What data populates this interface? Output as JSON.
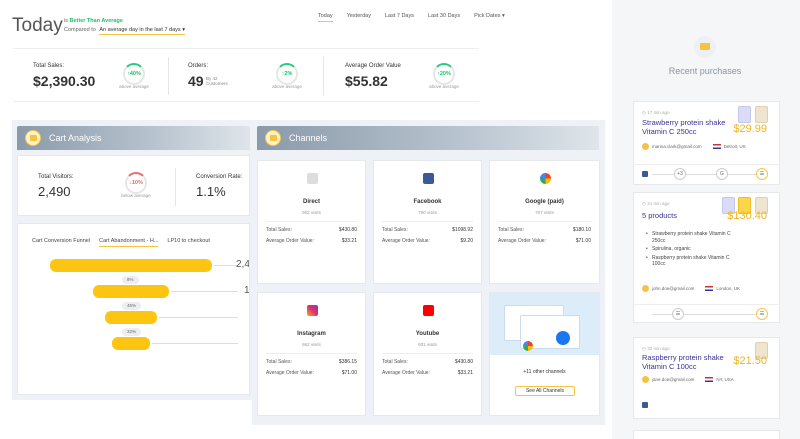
{
  "header": {
    "title": "Today",
    "status_prefix": "is",
    "status_value": "Better Than Average",
    "compare_prefix": "Compared to",
    "compare_value": "An average day in the last 7 days"
  },
  "date_tabs": [
    "Today",
    "Yesterday",
    "Last 7 Days",
    "Last 30 Days",
    "Pick Dates"
  ],
  "kpis": {
    "sales": {
      "label": "Total Sales:",
      "value": "$2,390.30",
      "pct": "40%",
      "caption": "above average"
    },
    "orders": {
      "label": "Orders:",
      "value": "49",
      "sub": "By 42 Customers",
      "pct": "2%",
      "caption": "above average"
    },
    "aov": {
      "label": "Average Order Value",
      "value": "$55.82",
      "pct": "20%",
      "caption": "above average"
    }
  },
  "cart": {
    "title": "Cart Analysis",
    "visitors_label": "Total Visitors:",
    "visitors_value": "2,490",
    "visitors_pct": "10%",
    "visitors_caption": "below average",
    "conv_label": "Conversion Rate:",
    "conv_value": "1.1%",
    "funnel_tabs": [
      "Cart Conversion Funnel",
      "Cart Abandonment - H...",
      "LP10 to checkout"
    ],
    "funnel": {
      "steps": [
        1.0,
        0.47,
        0.32,
        0.24
      ],
      "pills": [
        "8%",
        "45%",
        "32%"
      ],
      "num_top": "2,4",
      "num_mid": "1"
    }
  },
  "channels": {
    "title": "Channels",
    "sales_label": "Total Sales:",
    "aov_label": "Average Order Value:",
    "items": [
      {
        "name": "Direct",
        "visits": "952 visits",
        "sales": "$430.80",
        "aov": "$33.21",
        "icon": "direct-icon",
        "color": "#cccccc"
      },
      {
        "name": "Facebook",
        "visits": "790 visits",
        "sales": "$1098.92",
        "aov": "$9.20",
        "icon": "facebook-icon",
        "color": "#3b5998"
      },
      {
        "name": "Google (paid)",
        "visits": "707 visits",
        "sales": "$180.10",
        "aov": "$71.00",
        "icon": "google-icon",
        "color": "#ea4335"
      },
      {
        "name": "Instagram",
        "visits": "662 visits",
        "sales": "$386.15",
        "aov": "$71.00",
        "icon": "instagram-icon",
        "color": "#e1306c"
      },
      {
        "name": "Youtube",
        "visits": "601 visits",
        "sales": "$430.80",
        "aov": "$33.21",
        "icon": "youtube-icon",
        "color": "#ff0000"
      }
    ],
    "other_text": "+11 other channels",
    "see_all": "See All Channels"
  },
  "recent": {
    "title": "Recent purchases",
    "cards": [
      {
        "time": "17 min ago",
        "title_line1": "Strawberry protein shake",
        "title_line2": "Vitamin C 250cc",
        "price": "$29.99",
        "user": "marina.clark@gmail.com",
        "location": "Detroit, US",
        "journey_count": "+3"
      },
      {
        "time": "21 min ago",
        "title_line1": "5 products",
        "price": "$130.40",
        "items": [
          "Strawberry protein shake Vitamin C 250cc",
          "Spirulina, organic",
          "Raspberry protein shake Vitamin C 100cc"
        ],
        "user": "john.doe@gmail.com",
        "location": "London, UK"
      },
      {
        "time": "32 min ago",
        "title_line1": "Raspberry protein shake",
        "title_line2": "Vitamin C 100cc",
        "price": "$21.50",
        "user": "jane.doe@gmail.com",
        "location": "NY, USA"
      }
    ]
  }
}
